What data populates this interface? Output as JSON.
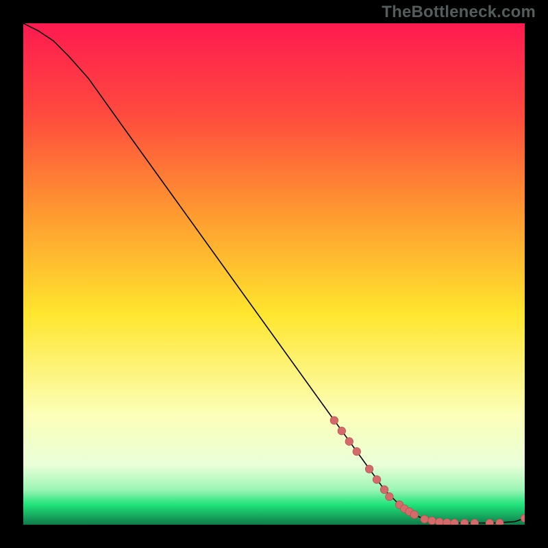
{
  "watermark": "TheBottleneck.com",
  "colors": {
    "page_bg": "#000000",
    "watermark": "#555c5c",
    "curve": "#000000",
    "marker_fill": "#d46a6a",
    "marker_stroke": "#a84a4a",
    "gradient_top": "#ff1a50",
    "gradient_upper": "#ff7d36",
    "gradient_yellow": "#ffe62e",
    "gradient_pale": "#f9ffcf",
    "gradient_green": "#20e37a",
    "gradient_deep": "#0f7a4a"
  },
  "chart_data": {
    "type": "line",
    "title": "",
    "xlabel": "",
    "ylabel": "",
    "xlim": [
      0,
      100
    ],
    "ylim": [
      0,
      100
    ],
    "grid": false,
    "legend": false,
    "series": [
      {
        "name": "curve",
        "x": [
          0,
          3,
          6,
          9,
          13,
          20,
          30,
          40,
          50,
          60,
          66,
          72,
          75,
          78,
          80,
          83,
          86,
          90,
          94,
          98,
          100
        ],
        "y": [
          100,
          98.5,
          96.5,
          93.5,
          89,
          79.2,
          65.3,
          51.4,
          37.5,
          23.6,
          15.3,
          7.0,
          4.0,
          2.0,
          1.1,
          0.55,
          0.35,
          0.33,
          0.35,
          0.6,
          1.3
        ]
      }
    ],
    "markers": {
      "name": "highlighted-points",
      "x": [
        62,
        63.5,
        65,
        66.5,
        69,
        70.5,
        72,
        73,
        75,
        76,
        77,
        78,
        80,
        81.5,
        83,
        84.5,
        86,
        88,
        90,
        93,
        95,
        100
      ],
      "y": [
        20.8,
        18.7,
        16.6,
        14.6,
        11.1,
        9.0,
        7.0,
        5.6,
        4.0,
        3.2,
        2.6,
        2.0,
        1.1,
        0.8,
        0.55,
        0.42,
        0.35,
        0.33,
        0.33,
        0.33,
        0.35,
        1.3
      ]
    }
  }
}
